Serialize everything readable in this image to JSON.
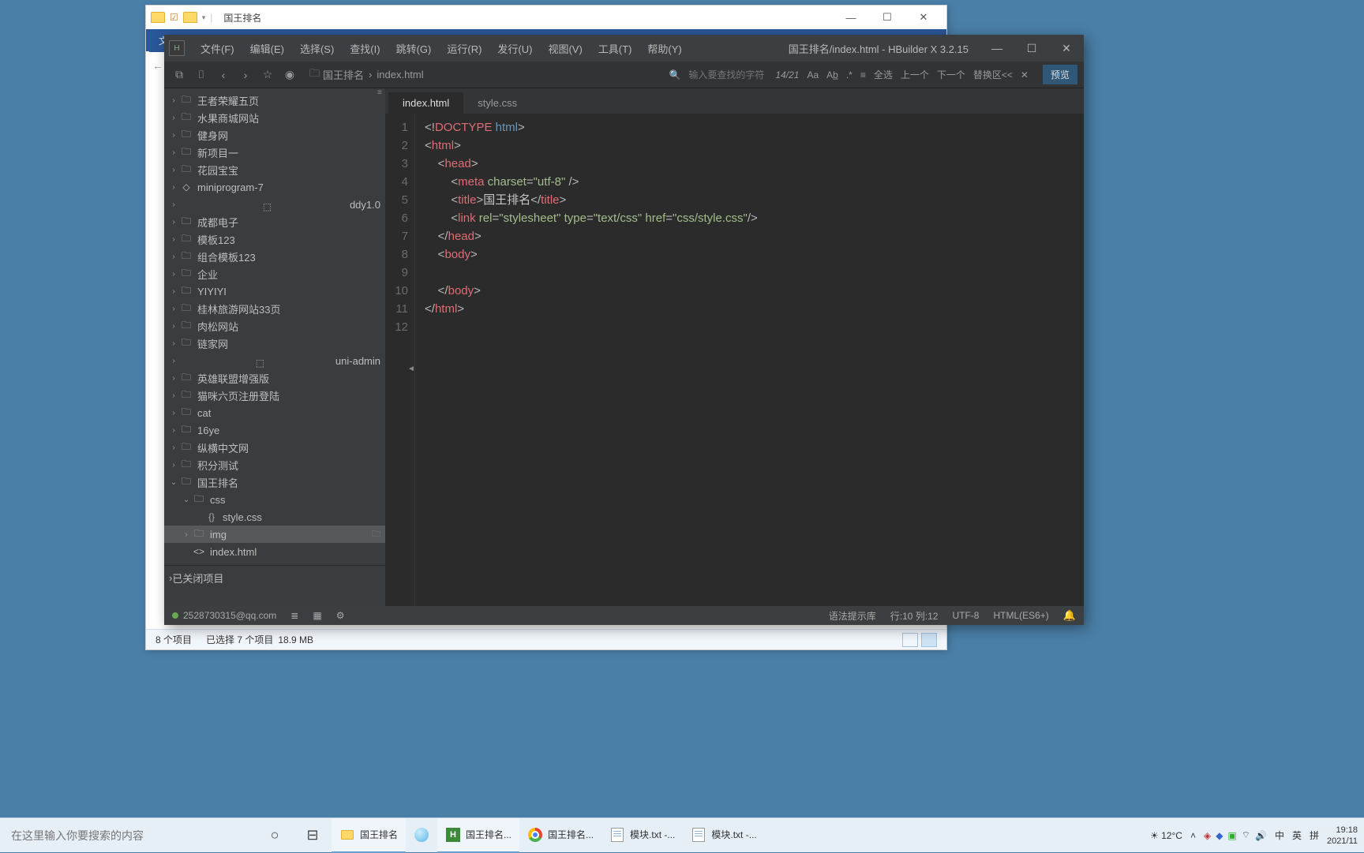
{
  "explorer": {
    "title": "国王排名",
    "ribbon_file": "文件",
    "winctrl": {
      "min": "—",
      "max": "☐",
      "close": "✕"
    },
    "status": {
      "items": "8 个项目",
      "selected": "已选择 7 个项目",
      "size": "18.9 MB"
    }
  },
  "hb": {
    "logo": "H",
    "menus": [
      "文件(F)",
      "编辑(E)",
      "选择(S)",
      "查找(I)",
      "跳转(G)",
      "运行(R)",
      "发行(U)",
      "视图(V)",
      "工具(T)",
      "帮助(Y)"
    ],
    "title": "国王排名/index.html - HBuilder X 3.2.15",
    "toolbar": {
      "crumb_root": "国王排名",
      "crumb_file": "index.html",
      "search_placeholder": "输入要查找的字符",
      "counter": "14/21",
      "btns": [
        "Aa",
        "Ab̲",
        ".*",
        "≡",
        "全选",
        "上一个",
        "下一个",
        "替换区<<",
        "✕"
      ],
      "preview": "预览"
    },
    "tabs": [
      {
        "label": "index.html",
        "active": true
      },
      {
        "label": "style.css",
        "active": false
      }
    ],
    "gutter": [
      "1",
      "2",
      "3",
      "4",
      "5",
      "6",
      "7",
      "8",
      "9",
      "10",
      "11",
      "12"
    ],
    "code": {
      "doctype": "DOCTYPE",
      "html": "html",
      "title_text": "国王排名",
      "attrs": {
        "charset": "charset",
        "utf8": "\"utf-8\"",
        "rel": "rel",
        "stylesheet": "\"stylesheet\"",
        "type": "type",
        "textcss": "\"text/css\"",
        "href": "href",
        "csspath": "\"css/style.css\""
      }
    },
    "tree": [
      {
        "label": "王者荣耀五页",
        "icon": "folder",
        "depth": 0
      },
      {
        "label": "水果商城网站",
        "icon": "folder",
        "depth": 0
      },
      {
        "label": "健身网",
        "icon": "folder",
        "depth": 0
      },
      {
        "label": "新项目一",
        "icon": "folder",
        "depth": 0
      },
      {
        "label": "花园宝宝",
        "icon": "folder",
        "depth": 0
      },
      {
        "label": "miniprogram-7",
        "icon": "js",
        "depth": 0
      },
      {
        "label": "ddy1.0",
        "icon": "code",
        "depth": 0
      },
      {
        "label": "成都电子",
        "icon": "folder",
        "depth": 0
      },
      {
        "label": "模板123",
        "icon": "folder",
        "depth": 0
      },
      {
        "label": "组合模板123",
        "icon": "folder",
        "depth": 0
      },
      {
        "label": "企业",
        "icon": "folder",
        "depth": 0
      },
      {
        "label": "YIYIYI",
        "icon": "folder",
        "depth": 0
      },
      {
        "label": "桂林旅游网站33页",
        "icon": "folder",
        "depth": 0
      },
      {
        "label": "肉松网站",
        "icon": "folder",
        "depth": 0
      },
      {
        "label": "链家网",
        "icon": "folder",
        "depth": 0
      },
      {
        "label": "uni-admin",
        "icon": "code",
        "depth": 0
      },
      {
        "label": "英雄联盟增强版",
        "icon": "folder",
        "depth": 0
      },
      {
        "label": "猫咪六页注册登陆",
        "icon": "folder",
        "depth": 0
      },
      {
        "label": "cat",
        "icon": "folder",
        "depth": 0
      },
      {
        "label": "16ye",
        "icon": "folder",
        "depth": 0
      },
      {
        "label": "纵横中文网",
        "icon": "folder",
        "depth": 0
      },
      {
        "label": "积分测试",
        "icon": "folder",
        "depth": 0
      },
      {
        "label": "国王排名",
        "icon": "folder",
        "depth": 0,
        "open": true
      },
      {
        "label": "css",
        "icon": "folder",
        "depth": 1,
        "open": true
      },
      {
        "label": "style.css",
        "icon": "css",
        "depth": 2,
        "leaf": true
      },
      {
        "label": "img",
        "icon": "folder",
        "depth": 1,
        "selected": true,
        "trail": true
      },
      {
        "label": "index.html",
        "icon": "html",
        "depth": 1,
        "leaf": true
      }
    ],
    "closed_projects": "已关闭项目",
    "status": {
      "user": "2528730315@qq.com",
      "hint": "语法提示库",
      "pos": "行:10 列:12",
      "enc": "UTF-8",
      "lang": "HTML(ES6+)"
    }
  },
  "taskbar": {
    "search_placeholder": "在这里输入你要搜索的内容",
    "apps": [
      {
        "label": "国王排名",
        "type": "folder",
        "active": true
      },
      {
        "label": "",
        "type": "orb"
      },
      {
        "label": "国王排名...",
        "type": "hb",
        "active": true
      },
      {
        "label": "国王排名...",
        "type": "chrome"
      },
      {
        "label": "模块.txt -...",
        "type": "txt"
      },
      {
        "label": "模块.txt -...",
        "type": "txt"
      }
    ],
    "weather": "12°C",
    "ime": [
      "中",
      "英",
      "拼"
    ],
    "time": "19:18",
    "date": "2021/11"
  }
}
